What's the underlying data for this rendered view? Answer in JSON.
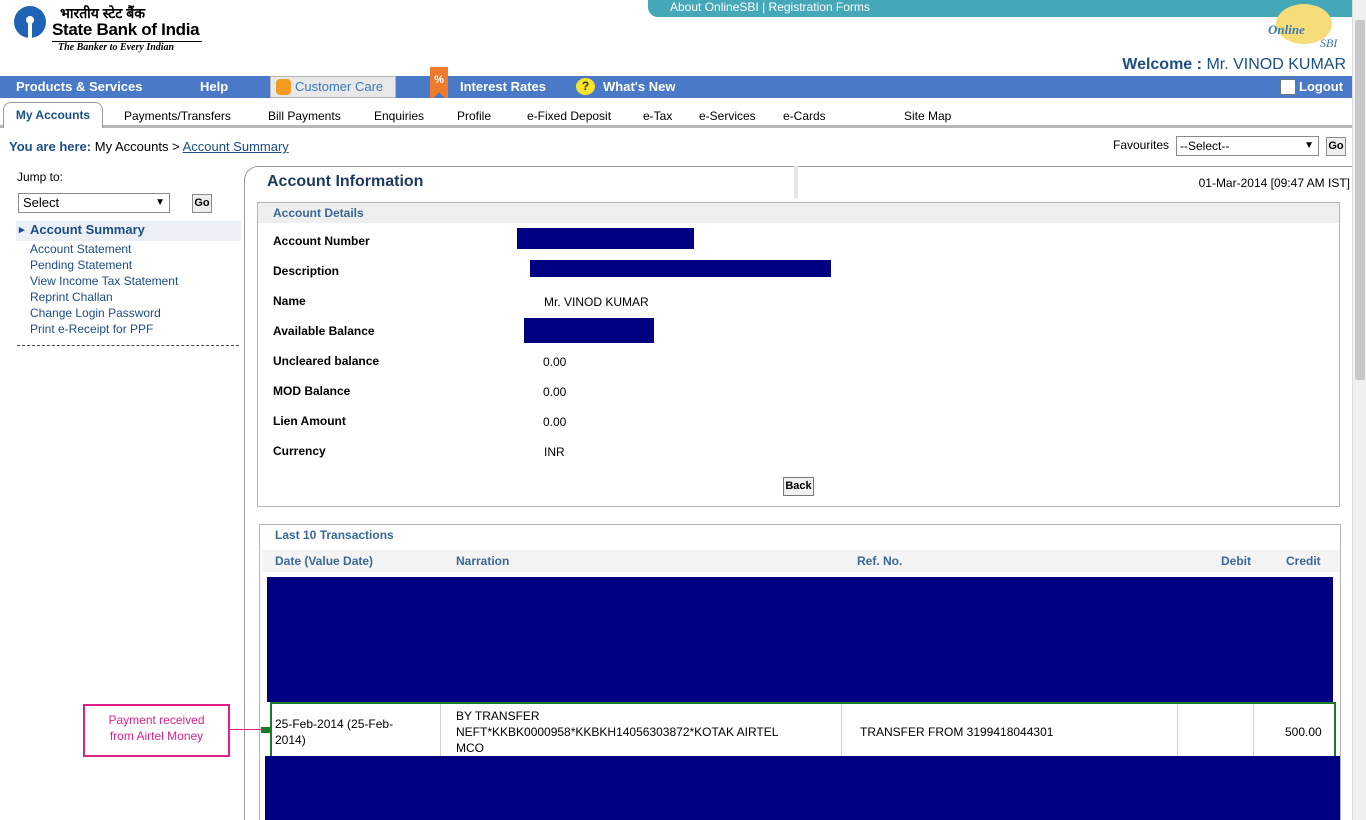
{
  "brand": {
    "hindi_name": "भारतीय स्टेट बैंक",
    "name": "State Bank of India",
    "tagline": "The Banker to Every Indian",
    "online_logo_text": "Online",
    "online_logo_sub": "SBI"
  },
  "top_links": {
    "about": "About OnlineSBI",
    "separator": "|",
    "registration": "Registration Forms"
  },
  "welcome": {
    "prefix": "Welcome :",
    "user": "Mr. VINOD KUMAR"
  },
  "main_nav": {
    "products": "Products & Services",
    "help": "Help",
    "customer_care": "Customer Care",
    "interest_rates": "Interest Rates",
    "interest_icon": "%",
    "whats_new": "What's New",
    "whats_new_icon": "?",
    "logout": "Logout"
  },
  "tabs": {
    "my_accounts": "My Accounts",
    "payments": "Payments/Transfers",
    "bill_payments": "Bill Payments",
    "enquiries": "Enquiries",
    "profile": "Profile",
    "fixed_deposit": "e-Fixed Deposit",
    "etax": "e-Tax",
    "eservices": "e-Services",
    "ecards": "e-Cards",
    "site_map": "Site Map"
  },
  "breadcrumb": {
    "label": "You are here:",
    "parent": "My Accounts",
    "separator": ">",
    "current": "Account Summary"
  },
  "favourites": {
    "label": "Favourites",
    "selected": "--Select--",
    "go": "Go"
  },
  "sidebar": {
    "jump_label": "Jump to:",
    "jump_selected": "Select",
    "go": "Go",
    "active": "Account Summary",
    "links": [
      "Account Statement",
      "Pending Statement",
      "View Income Tax Statement",
      "Reprint Challan",
      "Change Login Password",
      "Print e-Receipt for PPF"
    ]
  },
  "account_info": {
    "title": "Account Information",
    "datetime": "01-Mar-2014 [09:47 AM IST]",
    "details_header": "Account Details",
    "fields": {
      "account_number_label": "Account Number",
      "description_label": "Description",
      "name_label": "Name",
      "name_value": "Mr. VINOD KUMAR",
      "available_balance_label": "Available Balance",
      "uncleared_label": "Uncleared balance",
      "uncleared_value": "0.00",
      "mod_label": "MOD Balance",
      "mod_value": "0.00",
      "lien_label": "Lien Amount",
      "lien_value": "0.00",
      "currency_label": "Currency",
      "currency_value": "INR"
    },
    "back_button": "Back"
  },
  "transactions": {
    "header": "Last 10 Transactions",
    "columns": [
      "Date (Value Date)",
      "Narration",
      "Ref. No.",
      "Debit",
      "Credit"
    ],
    "highlighted_row": {
      "date_line1": "25-Feb-2014 (25-Feb-",
      "date_line2": "2014)",
      "narration_line1": "BY TRANSFER",
      "narration_line2": "NEFT*KKBK0000958*KKBKH14056303872*KOTAK AIRTEL",
      "narration_line3": "MCO",
      "ref_no": "TRANSFER FROM 3199418044301",
      "debit": "",
      "credit": "500.00"
    }
  },
  "annotation": {
    "line1": "Payment received",
    "line2": "from Airtel Money",
    "color": "#e0218a"
  },
  "colors": {
    "nav_blue": "#4a79c8",
    "heading_blue": "#1b4e86",
    "redaction": "#000080",
    "highlight_green": "#1a7a27"
  }
}
